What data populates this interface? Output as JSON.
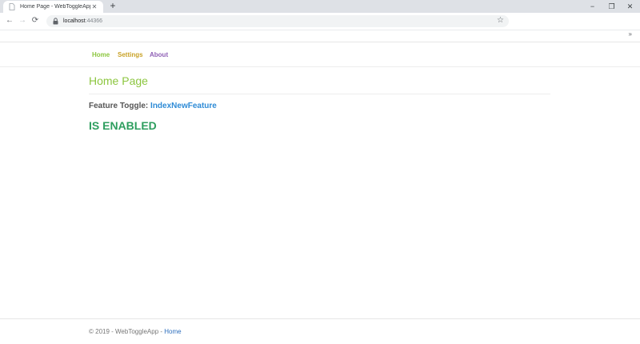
{
  "browser": {
    "tab_title": "Home Page - WebToggleApp",
    "new_tab_symbol": "+",
    "tab_close_symbol": "✕",
    "window_controls": {
      "minimize": "−",
      "restore": "❐",
      "close": "✕"
    },
    "nav": {
      "back": "←",
      "forward": "→",
      "reload": "⟳"
    },
    "url_host": "localhost",
    "url_port": ":44366",
    "bookmark_star": "☆",
    "bookmarks_overflow": "»"
  },
  "site": {
    "nav": [
      {
        "label": "Home",
        "color": "#8cc63f"
      },
      {
        "label": "Settings",
        "color": "#c9a227"
      },
      {
        "label": "About",
        "color": "#8e5fb5"
      }
    ],
    "page_title": "Home Page",
    "feature_label": "Feature Toggle:",
    "feature_name": "IndexNewFeature",
    "status": "IS ENABLED",
    "footer": {
      "text": "© 2019 - WebToggleApp - ",
      "link": "Home"
    }
  },
  "colors": {
    "title": "#8cc63f",
    "feature_link": "#2e8bd6",
    "status": "#2e9e5f"
  }
}
